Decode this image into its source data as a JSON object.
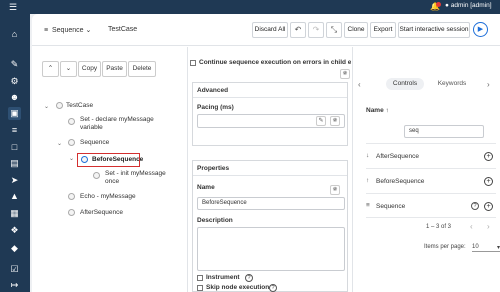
{
  "topbar": {
    "menu_icon": "hamburger-icon",
    "notification_icon": "bell-icon",
    "user_label": "admin [admin]"
  },
  "sidebar": {
    "icons": [
      "home-icon",
      "edit-icon",
      "gear-icon",
      "users-icon",
      "document-icon",
      "list-icon",
      "file-icon",
      "clipboard-icon",
      "rocket-icon",
      "chart-icon",
      "file-text-icon",
      "puzzle-icon",
      "plugin-icon",
      "check-icon",
      "logout-icon"
    ]
  },
  "toolbar": {
    "sequence_selector": "Sequence",
    "testcase_name": "TestCase",
    "discard_all": "Discard All",
    "clone": "Clone",
    "export": "Export",
    "start_session": "Start interactive session"
  },
  "tree_toolbar": {
    "copy": "Copy",
    "paste": "Paste",
    "delete": "Delete"
  },
  "tree": {
    "root": "TestCase",
    "set_declare_line1": "Set - declare myMessage",
    "set_declare_line2": "variable",
    "sequence": "Sequence",
    "before_sequence": "BeforeSequence",
    "set_init_line1": "Set - init myMessage",
    "set_init_line2": "once",
    "echo": "Echo - myMessage",
    "after_sequence": "AfterSequence"
  },
  "middle": {
    "continue_label": "Continue sequence execution on errors in child elements",
    "advanced_title": "Advanced",
    "pacing_label": "Pacing (ms)",
    "pacing_value": "",
    "properties_title": "Properties",
    "name_label": "Name",
    "name_value": "BeforeSequence",
    "description_label": "Description",
    "description_value": "",
    "instrument_label": "Instrument",
    "skip_label": "Skip node execution"
  },
  "right": {
    "tab_controls": "Controls",
    "tab_keywords": "Keywords",
    "name_header": "Name",
    "filter_value": "seq",
    "items": [
      "AfterSequence",
      "BeforeSequence",
      "Sequence"
    ],
    "range": "1 – 3 of 3",
    "items_per_page_label": "Items per page:",
    "items_per_page": "10"
  },
  "colors": {
    "nav_bg": "#1f3954",
    "accent": "#1e6fd9",
    "selection_border": "#d32f2f"
  }
}
